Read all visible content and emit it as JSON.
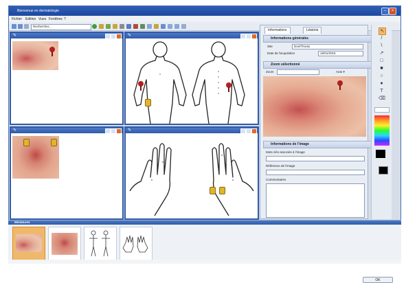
{
  "window": {
    "title": "Bienvenue en dermatologie"
  },
  "menu": [
    "Fichier",
    "Edition",
    "Vues",
    "Fenêtres",
    "?"
  ],
  "toolbar": {
    "search_value": "Rechercher..."
  },
  "viewers": [
    {
      "id": "closeup-arm"
    },
    {
      "id": "body-map-front-back"
    },
    {
      "id": "closeup-skin"
    },
    {
      "id": "hands-map"
    }
  ],
  "right_panel": {
    "tabs": [
      "Informations",
      "Lésions"
    ],
    "general_section": "Informations générales",
    "fields": [
      {
        "label": "Site",
        "value": "Dos/Thorax"
      },
      {
        "label": "Date de l'acquisition",
        "value": "16/01/2015"
      }
    ],
    "zoom_section": "Zoom sélectionné",
    "zoom_controls": {
      "level": "Zoom",
      "mode": "Auto ▾"
    },
    "image_info_section": "Informations de l'image",
    "image_fields": [
      "Mots clés associés à l'image",
      "Référence de l'image",
      "Commentaires"
    ]
  },
  "thumbnails_strip": {
    "title": "Miniatures",
    "count": 4
  },
  "footer": {
    "ok_label": "OK"
  },
  "colors": {
    "accent": "#2f5aa8",
    "title_bar": "#1d47a0",
    "pin": "#b41e1e",
    "marker": "#e2b52a"
  }
}
